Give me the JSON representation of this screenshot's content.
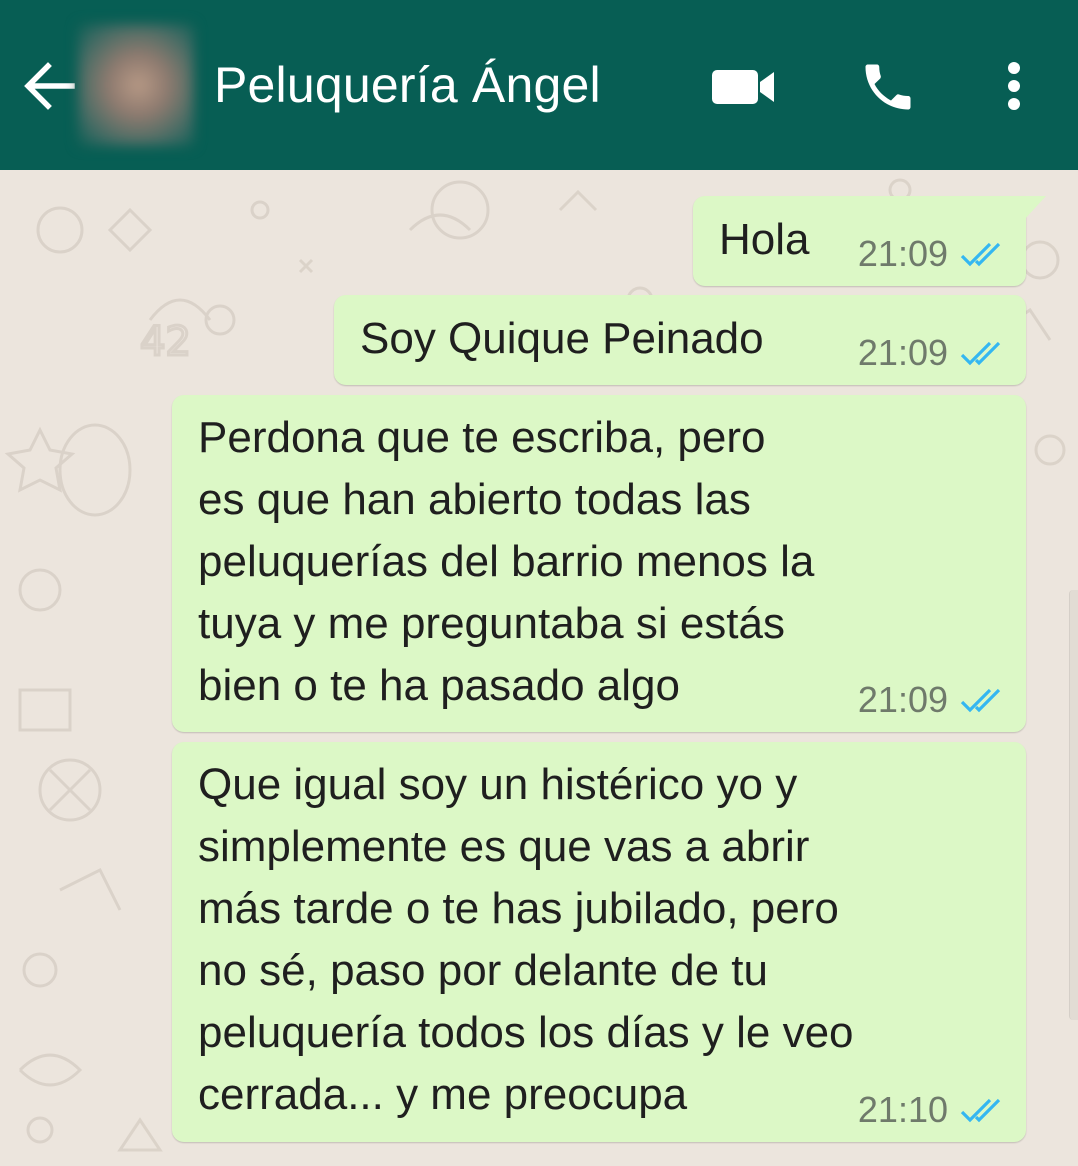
{
  "header": {
    "contact_name": "Peluquería Ángel",
    "back_icon": "arrow-left-icon",
    "video_icon": "video-call-icon",
    "call_icon": "phone-icon",
    "menu_icon": "more-vertical-icon",
    "background_color": "#075e54"
  },
  "chat": {
    "background_color": "#ece5dd",
    "outgoing_bubble_color": "#dcf8c6",
    "read_tick_color": "#34b7f1",
    "messages": [
      {
        "text": "Hola",
        "time": "21:09",
        "status": "read"
      },
      {
        "text": "Soy Quique Peinado",
        "time": "21:09",
        "status": "read"
      },
      {
        "text": "Perdona que te escriba, pero\nes que han abierto todas las\npeluquerías del barrio menos la\ntuya y me preguntaba si estás\nbien o te ha pasado algo",
        "time": "21:09",
        "status": "read"
      },
      {
        "text": "Que igual soy un histérico yo y\nsimplemente es que vas a abrir\nmás tarde o te has jubilado, pero\nno sé, paso por delante de tu\npeluquería todos los días y le veo\ncerrada... y me preocupa",
        "time": "21:10",
        "status": "read"
      }
    ]
  }
}
